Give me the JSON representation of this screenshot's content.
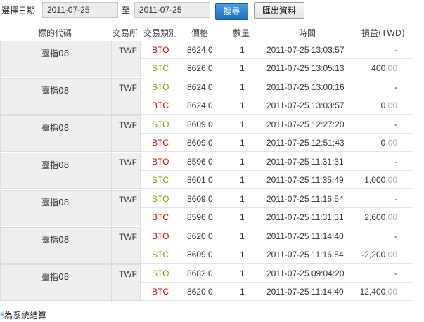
{
  "filter": {
    "label": "選擇日期",
    "start_date": "2011-07-25",
    "to_label": "至",
    "end_date": "2011-07-25",
    "search_label": "搜尋",
    "export_label": "匯出資料"
  },
  "columns": {
    "symbol": "標的代碼",
    "exchange": "交易所",
    "type": "交易類別",
    "price": "價格",
    "qty": "數量",
    "time": "時間",
    "pl": "損益(TWD)"
  },
  "colors": {
    "buy_type": "#d40000",
    "sell_type": "#7aa500",
    "accent": "#1e88d8"
  },
  "groups": [
    {
      "symbol": "臺指08",
      "exchange": "TWF",
      "rows": [
        {
          "type": "BTO",
          "color": "red",
          "price": "8624.0",
          "qty": "1",
          "time": "2011-07-25 13:03:57",
          "pl_int": "-",
          "pl_dec": ""
        },
        {
          "type": "STC",
          "color": "green",
          "price": "8626.0",
          "qty": "1",
          "time": "2011-07-25 13:05:13",
          "pl_int": "400",
          "pl_dec": ".00"
        }
      ]
    },
    {
      "symbol": "臺指08",
      "exchange": "TWF",
      "rows": [
        {
          "type": "STO",
          "color": "green",
          "price": "8624.0",
          "qty": "1",
          "time": "2011-07-25 13:00:16",
          "pl_int": "-",
          "pl_dec": ""
        },
        {
          "type": "BTC",
          "color": "red",
          "price": "8624.0",
          "qty": "1",
          "time": "2011-07-25 13:03:57",
          "pl_int": "0",
          "pl_dec": ".00"
        }
      ]
    },
    {
      "symbol": "臺指08",
      "exchange": "TWF",
      "rows": [
        {
          "type": "STO",
          "color": "green",
          "price": "8609.0",
          "qty": "1",
          "time": "2011-07-25 12:27:20",
          "pl_int": "-",
          "pl_dec": ""
        },
        {
          "type": "BTC",
          "color": "red",
          "price": "8609.0",
          "qty": "1",
          "time": "2011-07-25 12:51:43",
          "pl_int": "0",
          "pl_dec": ".00"
        }
      ]
    },
    {
      "symbol": "臺指08",
      "exchange": "TWF",
      "rows": [
        {
          "type": "BTO",
          "color": "red",
          "price": "8596.0",
          "qty": "1",
          "time": "2011-07-25 11:31:31",
          "pl_int": "-",
          "pl_dec": ""
        },
        {
          "type": "STC",
          "color": "green",
          "price": "8601.0",
          "qty": "1",
          "time": "2011-07-25 11:35:49",
          "pl_int": "1,000",
          "pl_dec": ".00"
        }
      ]
    },
    {
      "symbol": "臺指08",
      "exchange": "TWF",
      "rows": [
        {
          "type": "STO",
          "color": "green",
          "price": "8609.0",
          "qty": "1",
          "time": "2011-07-25 11:16:54",
          "pl_int": "-",
          "pl_dec": ""
        },
        {
          "type": "BTC",
          "color": "red",
          "price": "8596.0",
          "qty": "1",
          "time": "2011-07-25 11:31:31",
          "pl_int": "2,600",
          "pl_dec": ".00"
        }
      ]
    },
    {
      "symbol": "臺指08",
      "exchange": "TWF",
      "rows": [
        {
          "type": "BTO",
          "color": "red",
          "price": "8620.0",
          "qty": "1",
          "time": "2011-07-25 11:14:40",
          "pl_int": "-",
          "pl_dec": ""
        },
        {
          "type": "STC",
          "color": "green",
          "price": "8609.0",
          "qty": "1",
          "time": "2011-07-25 11:16:54",
          "pl_int": "-2,200",
          "pl_dec": ".00"
        }
      ]
    },
    {
      "symbol": "臺指08",
      "exchange": "TWF",
      "rows": [
        {
          "type": "STO",
          "color": "green",
          "price": "8682.0",
          "qty": "1",
          "time": "2011-07-25 09:04:20",
          "pl_int": "-",
          "pl_dec": ""
        },
        {
          "type": "BTC",
          "color": "red",
          "price": "8620.0",
          "qty": "1",
          "time": "2011-07-25 11:14:40",
          "pl_int": "12,400",
          "pl_dec": ".00"
        }
      ]
    }
  ],
  "footnote": {
    "star": "*",
    "text": "為系統結算"
  }
}
